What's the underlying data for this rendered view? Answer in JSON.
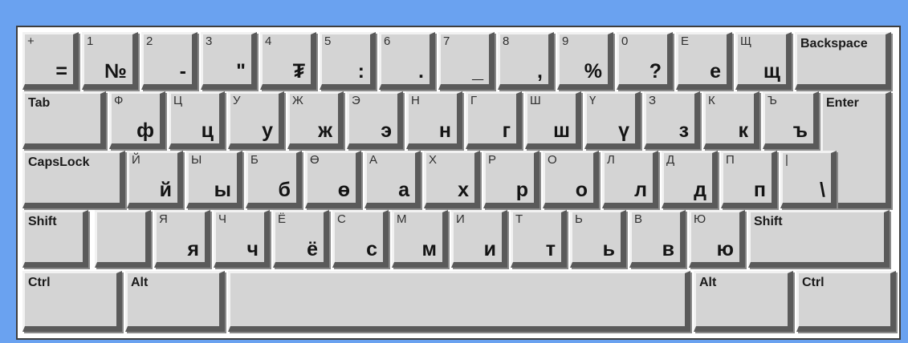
{
  "keyboard": {
    "row1": [
      {
        "sub": "+",
        "main": "="
      },
      {
        "sub": "1",
        "main": "№"
      },
      {
        "sub": "2",
        "main": "-"
      },
      {
        "sub": "3",
        "main": "\""
      },
      {
        "sub": "4",
        "main": "₮"
      },
      {
        "sub": "5",
        "main": ":"
      },
      {
        "sub": "6",
        "main": "."
      },
      {
        "sub": "7",
        "main": "_"
      },
      {
        "sub": "8",
        "main": ","
      },
      {
        "sub": "9",
        "main": "%"
      },
      {
        "sub": "0",
        "main": "?"
      },
      {
        "sub": "Е",
        "main": "е"
      },
      {
        "sub": "Щ",
        "main": "щ"
      },
      {
        "label": "Backspace"
      }
    ],
    "row2": [
      {
        "label": "Tab"
      },
      {
        "sub": "Ф",
        "main": "ф"
      },
      {
        "sub": "Ц",
        "main": "ц"
      },
      {
        "sub": "У",
        "main": "у"
      },
      {
        "sub": "Ж",
        "main": "ж"
      },
      {
        "sub": "Э",
        "main": "э"
      },
      {
        "sub": "Н",
        "main": "н"
      },
      {
        "sub": "Г",
        "main": "г"
      },
      {
        "sub": "Ш",
        "main": "ш"
      },
      {
        "sub": "Ү",
        "main": "ү"
      },
      {
        "sub": "З",
        "main": "з"
      },
      {
        "sub": "К",
        "main": "к"
      },
      {
        "sub": "Ъ",
        "main": "ъ"
      },
      {
        "label": "Enter"
      }
    ],
    "row3": [
      {
        "label": "CapsLock"
      },
      {
        "sub": "Й",
        "main": "й"
      },
      {
        "sub": "Ы",
        "main": "ы"
      },
      {
        "sub": "Б",
        "main": "б"
      },
      {
        "sub": "Ө",
        "main": "ө"
      },
      {
        "sub": "А",
        "main": "а"
      },
      {
        "sub": "Х",
        "main": "х"
      },
      {
        "sub": "Р",
        "main": "р"
      },
      {
        "sub": "О",
        "main": "о"
      },
      {
        "sub": "Л",
        "main": "л"
      },
      {
        "sub": "Д",
        "main": "д"
      },
      {
        "sub": "П",
        "main": "п"
      },
      {
        "sub": "|",
        "main": "\\"
      }
    ],
    "row4": [
      {
        "label": "Shift"
      },
      {
        "sub": "",
        "main": ""
      },
      {
        "sub": "Я",
        "main": "я"
      },
      {
        "sub": "Ч",
        "main": "ч"
      },
      {
        "sub": "Ё",
        "main": "ё"
      },
      {
        "sub": "С",
        "main": "с"
      },
      {
        "sub": "М",
        "main": "м"
      },
      {
        "sub": "И",
        "main": "и"
      },
      {
        "sub": "Т",
        "main": "т"
      },
      {
        "sub": "Ь",
        "main": "ь"
      },
      {
        "sub": "В",
        "main": "в"
      },
      {
        "sub": "Ю",
        "main": "ю"
      },
      {
        "label": "Shift"
      }
    ],
    "row5": [
      {
        "label": "Ctrl"
      },
      {
        "label": "Alt"
      },
      {
        "label": ""
      },
      {
        "label": "Alt"
      },
      {
        "label": "Ctrl"
      }
    ]
  }
}
